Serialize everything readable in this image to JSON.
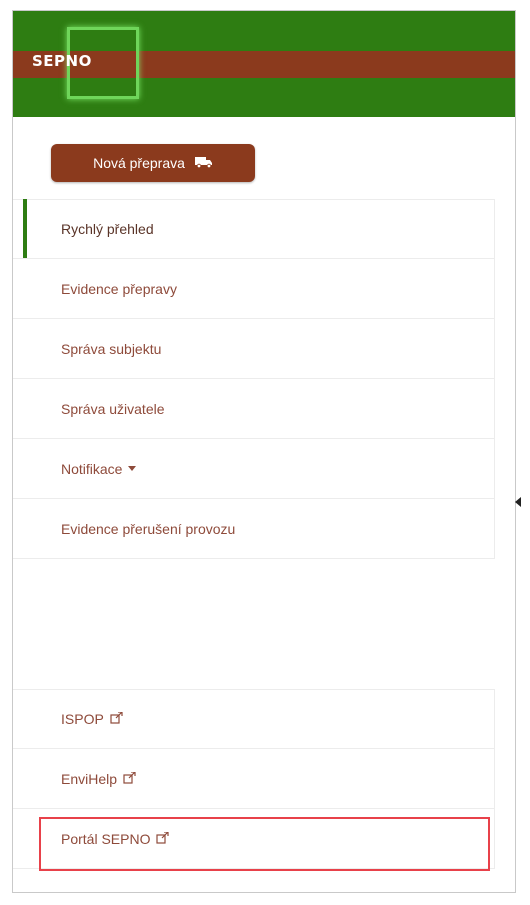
{
  "brand": {
    "logo_text": "SEPNO"
  },
  "colors": {
    "header_green": "#2e7d12",
    "brand_brown": "#8b3a1d",
    "link_text": "#8e4a3a",
    "highlight_red": "#e8414a"
  },
  "actions": {
    "new_transport_label": "Nová přeprava",
    "new_transport_icon": "truck-icon"
  },
  "nav": {
    "items": [
      {
        "label": "Rychlý přehled",
        "active": true
      },
      {
        "label": "Evidence přepravy"
      },
      {
        "label": "Správa subjektu"
      },
      {
        "label": "Správa uživatele"
      },
      {
        "label": "Notifikace",
        "has_dropdown": true
      },
      {
        "label": "Evidence přerušení provozu"
      }
    ]
  },
  "external_links": {
    "items": [
      {
        "label": "ISPOP",
        "icon": "external-link-icon"
      },
      {
        "label": "EnviHelp",
        "icon": "external-link-icon"
      },
      {
        "label": "Portál SEPNO",
        "icon": "external-link-icon",
        "highlighted": true
      }
    ]
  }
}
